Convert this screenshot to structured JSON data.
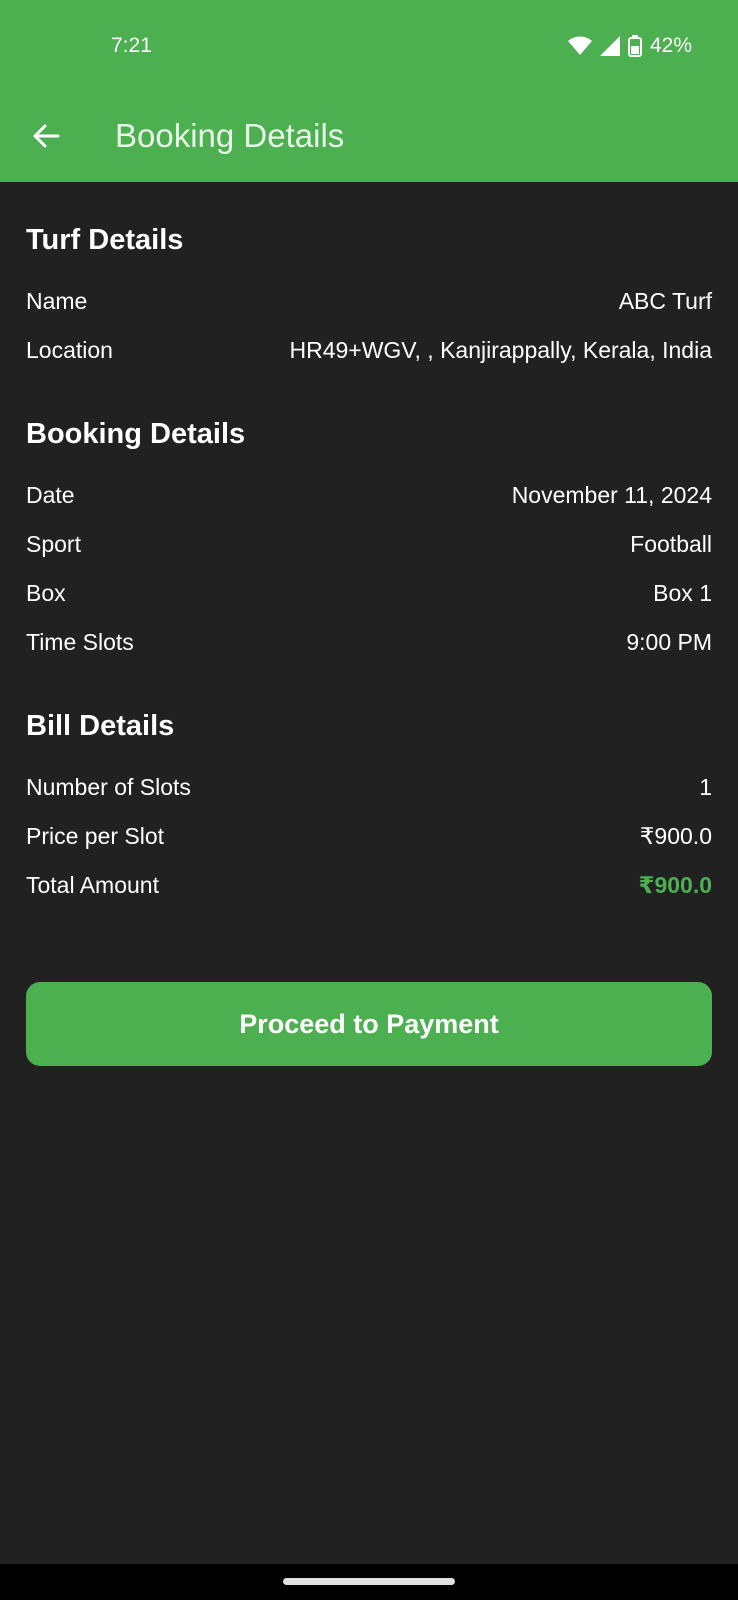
{
  "status_bar": {
    "time": "7:21",
    "battery": "42%",
    "icons": [
      "wifi-icon",
      "signal-icon",
      "battery-icon"
    ]
  },
  "app_bar": {
    "title": "Booking Details",
    "back_icon": "arrow-left-icon",
    "background_color": "#4caf50"
  },
  "turf": {
    "heading": "Turf Details",
    "name_label": "Name",
    "name_value": "ABC Turf",
    "location_label": "Location",
    "location_value": "HR49+WGV, , Kanjirappally, Kerala, India"
  },
  "booking": {
    "heading": "Booking Details",
    "date_label": "Date",
    "date_value": "November 11, 2024",
    "sport_label": "Sport",
    "sport_value": "Football",
    "box_label": "Box",
    "box_value": "Box 1",
    "slots_label": "Time Slots",
    "slots_value": "9:00 PM"
  },
  "bill": {
    "heading": "Bill Details",
    "count_label": "Number of Slots",
    "count_value": "1",
    "price_label": "Price per Slot",
    "price_value": "₹900.0",
    "total_label": "Total Amount",
    "total_value": "₹900.0",
    "total_color": "#4caf50"
  },
  "actions": {
    "proceed_label": "Proceed to Payment"
  }
}
